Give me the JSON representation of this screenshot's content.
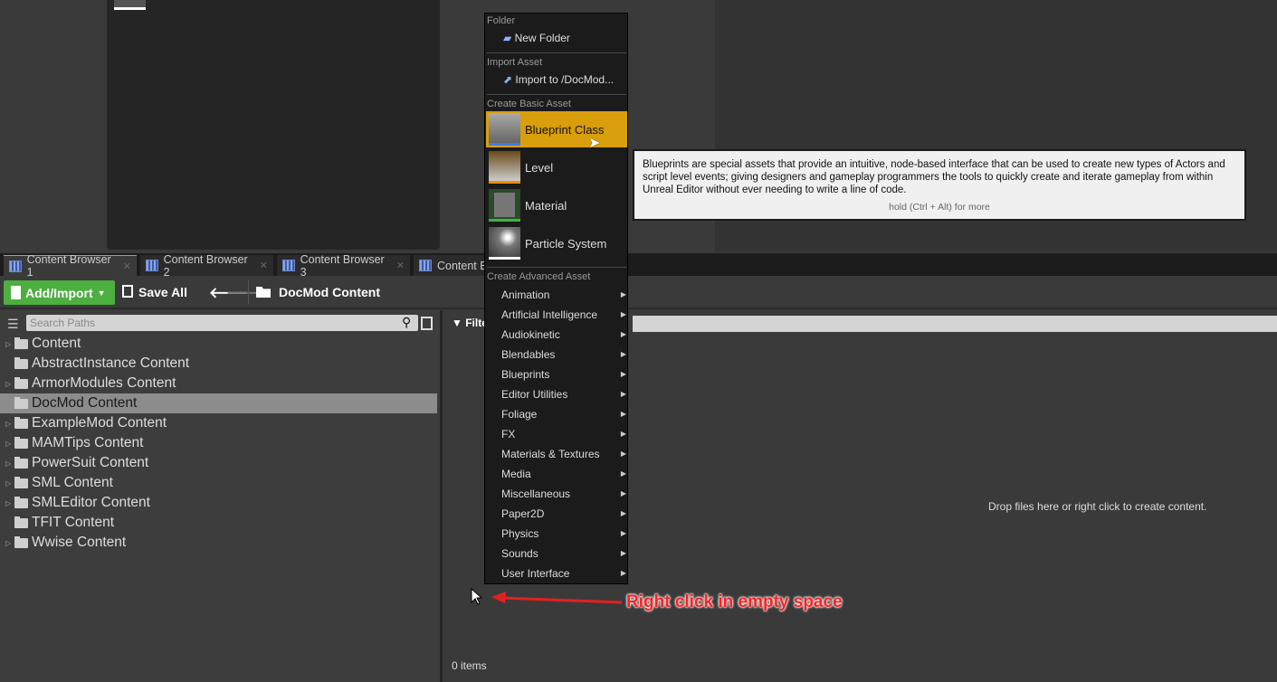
{
  "tabs": [
    {
      "label": "Content Browser 1",
      "active": true
    },
    {
      "label": "Content Browser 2"
    },
    {
      "label": "Content Browser 3"
    },
    {
      "label": "Content Browser 4"
    }
  ],
  "toolbar": {
    "add_import": "Add/Import",
    "save_all": "Save All",
    "path": "DocMod Content"
  },
  "paths": {
    "search_placeholder": "Search Paths",
    "items": [
      {
        "label": "Content",
        "expandable": true
      },
      {
        "label": "AbstractInstance Content"
      },
      {
        "label": "ArmorModules Content",
        "expandable": true
      },
      {
        "label": "DocMod Content",
        "selected": true
      },
      {
        "label": "ExampleMod Content",
        "expandable": true
      },
      {
        "label": "MAMTips Content",
        "expandable": true
      },
      {
        "label": "PowerSuit Content",
        "expandable": true
      },
      {
        "label": "SML Content",
        "expandable": true
      },
      {
        "label": "SMLEditor Content",
        "expandable": true
      },
      {
        "label": "TFIT Content"
      },
      {
        "label": "Wwise Content",
        "expandable": true
      }
    ]
  },
  "assets": {
    "filter_label": "Filters",
    "empty_text": "Drop files here or right click to create content.",
    "count": "0 items"
  },
  "menu": {
    "folder_header": "Folder",
    "new_folder": "New Folder",
    "import_header": "Import Asset",
    "import_to": "Import to /DocMod...",
    "basic_header": "Create Basic Asset",
    "basic": [
      {
        "label": "Blueprint Class",
        "color": "#3d7de8"
      },
      {
        "label": "Level",
        "color": "#f08c00"
      },
      {
        "label": "Material",
        "color": "#3fb33f"
      },
      {
        "label": "Particle System",
        "color": "#ffffff"
      }
    ],
    "advanced_header": "Create Advanced Asset",
    "advanced": [
      "Animation",
      "Artificial Intelligence",
      "Audiokinetic",
      "Blendables",
      "Blueprints",
      "Editor Utilities",
      "Foliage",
      "FX",
      "Materials & Textures",
      "Media",
      "Miscellaneous",
      "Paper2D",
      "Physics",
      "Sounds",
      "User Interface"
    ]
  },
  "tooltip": {
    "text": "Blueprints are special assets that provide an intuitive, node-based interface that can be used to create new types of Actors and script level events; giving designers and gameplay programmers the tools to quickly create and iterate gameplay from within Unreal Editor without ever needing to write a line of code.",
    "hint": "hold (Ctrl + Alt) for more"
  },
  "annotation": "Right click in empty space"
}
